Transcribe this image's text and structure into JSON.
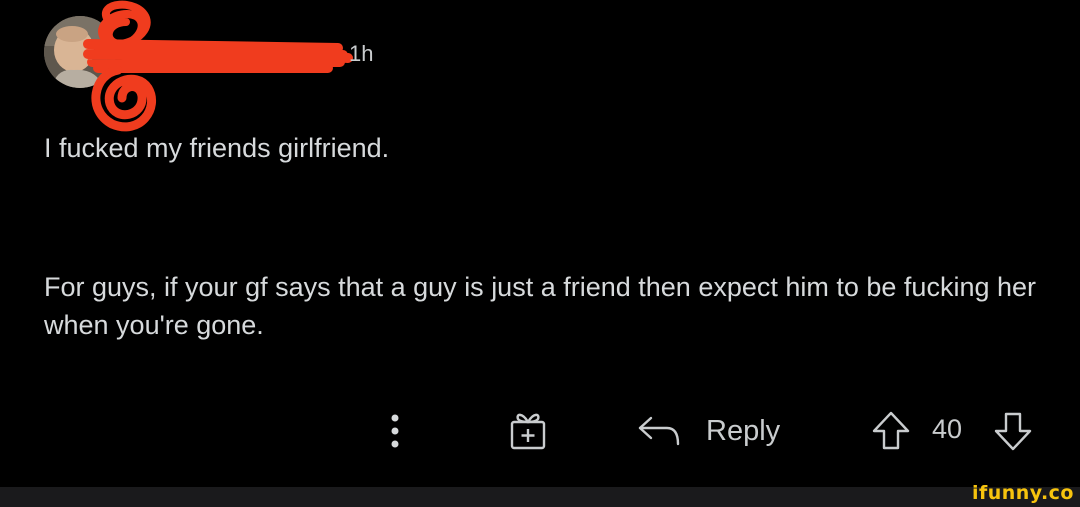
{
  "comment": {
    "username": "",
    "timestamp": "1h",
    "title": "I fucked my friends girlfriend.",
    "body": "For guys, if your gf says that a guy is just a friend then expect him to be fucking her when you're gone."
  },
  "actions": {
    "more_icon": "more-vertical-icon",
    "award_icon": "award-gift-icon",
    "reply_icon": "reply-arrow-icon",
    "reply_label": "Reply",
    "upvote_icon": "upvote-arrow-icon",
    "score": "40",
    "downvote_icon": "downvote-arrow-icon"
  },
  "watermark": {
    "text": "ifunny.co"
  },
  "colors": {
    "background": "#000000",
    "text": "#d7dadc",
    "redaction": "#f03c1e",
    "watermark": "#f7c40e"
  }
}
